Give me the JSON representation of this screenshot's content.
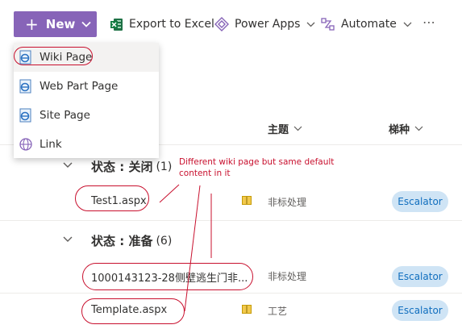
{
  "toolbar": {
    "new_label": "New",
    "export_label": "Export to Excel",
    "powerapps_label": "Power Apps",
    "automate_label": "Automate",
    "more_label": "⋯"
  },
  "menu": {
    "items": [
      {
        "label": "Wiki Page",
        "icon": "page-icon"
      },
      {
        "label": "Web Part Page",
        "icon": "page-icon"
      },
      {
        "label": "Site Page",
        "icon": "page-icon"
      },
      {
        "label": "Link",
        "icon": "globe-icon"
      }
    ]
  },
  "columns": {
    "subject": "主题",
    "elevator": "梯种"
  },
  "groups": [
    {
      "label": "状态 : 关闭",
      "count": "(1)",
      "rows": [
        {
          "name": "Test1.aspx",
          "subject": "非标处理",
          "tag": "Escalator"
        }
      ]
    },
    {
      "label": "状态 : 准备",
      "count": "(6)",
      "rows": [
        {
          "name": "1000143123-28侧壁逃生门非...",
          "subject": "非标处理",
          "tag": "Escalator"
        },
        {
          "name": "Template.aspx",
          "subject": "工艺",
          "tag": "Escalator"
        }
      ]
    }
  ],
  "annotation": {
    "line1": "Different wiki page but same default",
    "line2": "content in it"
  },
  "colors": {
    "accent": "#8764b8",
    "annotation": "#c8102e",
    "tag_bg": "#cfe4f5",
    "tag_text": "#106ebe"
  }
}
